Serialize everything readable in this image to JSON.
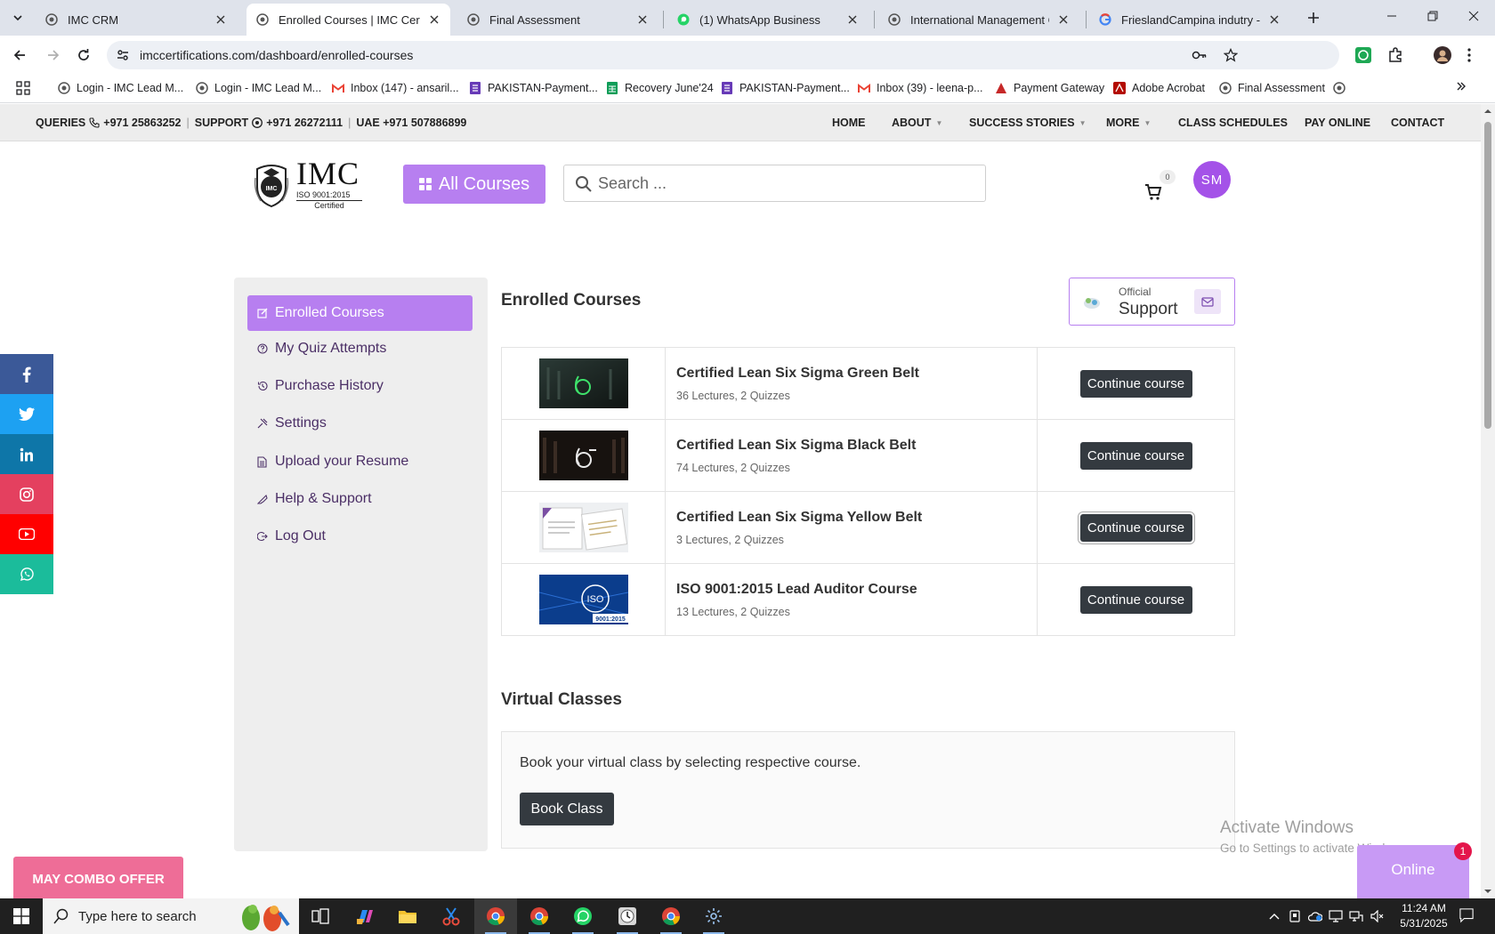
{
  "browser": {
    "tabs": [
      {
        "title": "IMC CRM"
      },
      {
        "title": "Enrolled Courses | IMC Certifica"
      },
      {
        "title": "Final Assessment"
      },
      {
        "title": "(1) WhatsApp Business"
      },
      {
        "title": "International Management Con"
      },
      {
        "title": "FrieslandCampina indutry - Goo"
      }
    ],
    "url": "imccertifications.com/dashboard/enrolled-courses",
    "bookmarks": [
      {
        "label": "Login - IMC Lead M..."
      },
      {
        "label": "Login - IMC Lead M..."
      },
      {
        "label": "Inbox (147) - ansaril..."
      },
      {
        "label": "PAKISTAN-Payment..."
      },
      {
        "label": "Recovery June'24"
      },
      {
        "label": "PAKISTAN-Payment..."
      },
      {
        "label": "Inbox (39) - leena-p..."
      },
      {
        "label": "Payment Gateway"
      },
      {
        "label": "Adobe Acrobat"
      },
      {
        "label": "Final Assessment"
      }
    ]
  },
  "topbar": {
    "queries_label": "QUERIES",
    "queries_phone": "+971 25863252",
    "support_label": "SUPPORT",
    "support_phone": "+971 26272111",
    "uae_label": "UAE +971 507886899",
    "nav": [
      {
        "label": "HOME"
      },
      {
        "label": "ABOUT"
      },
      {
        "label": "SUCCESS STORIES"
      },
      {
        "label": "MORE"
      },
      {
        "label": "CLASS SCHEDULES"
      },
      {
        "label": "PAY ONLINE"
      },
      {
        "label": "CONTACT"
      }
    ]
  },
  "header": {
    "logo_text": "IMC",
    "logo_iso": "ISO 9001:2015",
    "logo_certified": "Certified",
    "logo_badge": "IMC",
    "all_courses": "All Courses",
    "search_placeholder": "Search ...",
    "cart_count": "0",
    "avatar_initials": "SM"
  },
  "sidebar": {
    "items": [
      {
        "label": "Enrolled Courses",
        "active": true
      },
      {
        "label": "My Quiz Attempts"
      },
      {
        "label": "Purchase History"
      },
      {
        "label": "Settings"
      },
      {
        "label": "Upload your Resume"
      },
      {
        "label": "Help & Support"
      },
      {
        "label": "Log Out"
      }
    ]
  },
  "main": {
    "title": "Enrolled Courses",
    "support_small": "Official",
    "support_big": "Support",
    "courses": [
      {
        "title": "Certified Lean Six Sigma Green Belt",
        "meta": "36 Lectures, 2 Quizzes",
        "action": "Continue course"
      },
      {
        "title": "Certified Lean Six Sigma Black Belt",
        "meta": "74 Lectures, 2 Quizzes",
        "action": "Continue course"
      },
      {
        "title": "Certified Lean Six Sigma Yellow Belt",
        "meta": "3 Lectures, 2 Quizzes",
        "action": "Continue course"
      },
      {
        "title": "ISO 9001:2015 Lead Auditor Course",
        "meta": "13 Lectures, 2 Quizzes",
        "action": "Continue course"
      }
    ],
    "thumb_text": {
      "iso": "ISO",
      "iso_sub": "9001:2015"
    },
    "virtual_title": "Virtual Classes",
    "virtual_text": "Book your virtual class by selecting respective course.",
    "book_class": "Book Class"
  },
  "floating": {
    "combo_offer": "MAY COMBO OFFER",
    "online": "Online",
    "online_badge": "1",
    "activate_title": "Activate Windows",
    "activate_sub": "Go to Settings to activate Windows."
  },
  "taskbar": {
    "search_placeholder": "Type here to search",
    "time": "11:24 AM",
    "date": "5/31/2025"
  },
  "colors": {
    "brand_purple": "#b77ff0",
    "avatar_purple": "#a452e8",
    "button_dark": "#343a40",
    "combo_pink": "#ee6d97",
    "facebook": "#3b5998",
    "twitter": "#1da1f2",
    "linkedin": "#0e76a8",
    "instagram": "#e4405f",
    "youtube": "#ff0000",
    "whatsapp": "#1bbc9b"
  }
}
